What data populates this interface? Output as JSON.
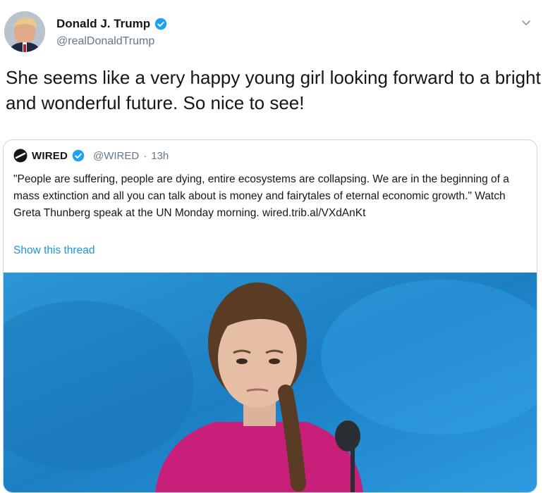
{
  "tweet": {
    "author_name": "Donald J. Trump",
    "author_handle": "@realDonaldTrump",
    "text": "She seems like a very happy young girl looking forward to a bright and wonderful future. So nice to see!"
  },
  "quoted_tweet": {
    "author_name": "WIRED",
    "author_handle": "@WIRED",
    "separator": "·",
    "time": "13h",
    "text": "\"People are suffering, people are dying, entire ecosystems are collapsing. We are in the beginning of a mass extinction and all you can talk about is money and fairytales of eternal economic growth.\" Watch Greta Thunberg speak at the UN Monday morning. wired.trib.al/VXdAnKt",
    "thread_link": "Show this thread"
  },
  "icons": {
    "verified": "verified-badge-icon",
    "menu": "chevron-down-icon",
    "wired_logo": "wired-logo-icon"
  },
  "colors": {
    "accent_blue": "#1da1f2",
    "link_blue": "#1b95e0",
    "secondary_text": "#657786",
    "border": "#ccd6dd",
    "media_background": "#1f86c8",
    "shirt_pink": "#c8207a"
  }
}
